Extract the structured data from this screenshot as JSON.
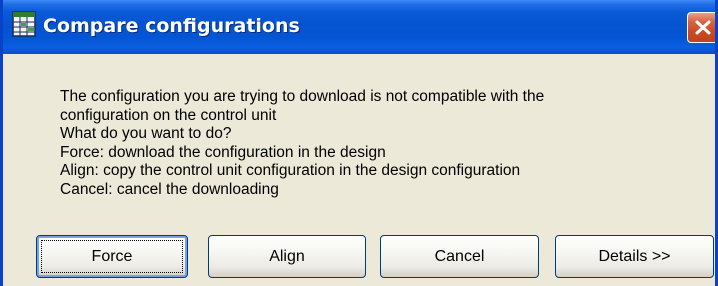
{
  "window": {
    "title": "Compare configurations",
    "icon": "spreadsheet-icon",
    "close_icon": "close-icon"
  },
  "message": {
    "lines": [
      "The configuration you are trying to download is not compatible with the",
      "configuration on the control unit",
      "What do you want to do?",
      "Force: download the configuration in the design",
      "Align: copy the control unit configuration in the design configuration",
      "Cancel: cancel the downloading"
    ]
  },
  "buttons": {
    "force": "Force",
    "align": "Align",
    "cancel": "Cancel",
    "details": "Details >>"
  },
  "colors": {
    "titlebar": "#0553d0",
    "dialog_bg": "#ece9d8",
    "close_button": "#cc4a25"
  }
}
